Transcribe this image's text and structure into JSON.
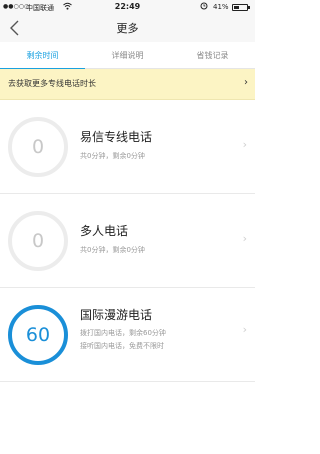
{
  "status_bar": {
    "signal": "●●○○○",
    "carrier": "中国联通",
    "wifi_icon": "wifi-icon",
    "time": "22:49",
    "alarm_icon": "alarm-icon",
    "battery_pct": "41%",
    "battery_level": 0.41
  },
  "nav": {
    "title": "更多",
    "back_icon": "chevron-left-icon"
  },
  "tabs": [
    {
      "label": "剩余时间",
      "active": true
    },
    {
      "label": "详细说明",
      "active": false
    },
    {
      "label": "省钱记录",
      "active": false
    }
  ],
  "banner": {
    "text": "去获取更多专线电话时长",
    "chevron": "›"
  },
  "cards": [
    {
      "value": "0",
      "title": "易信专线电话",
      "lines": [
        "共0分钟，剩余0分钟"
      ],
      "chevron": "›"
    },
    {
      "value": "0",
      "title": "多人电话",
      "lines": [
        "共0分钟，剩余0分钟"
      ],
      "chevron": "›"
    },
    {
      "value": "60",
      "title": "国际漫游电话",
      "lines": [
        "拨打国内电话，剩余60分钟",
        "接听国内电话，免费不限时"
      ],
      "chevron": "›"
    }
  ],
  "colors": {
    "accent": "#1aa1e0",
    "ring_active": "#1a8fd8",
    "banner_bg": "#fcf4c4"
  }
}
